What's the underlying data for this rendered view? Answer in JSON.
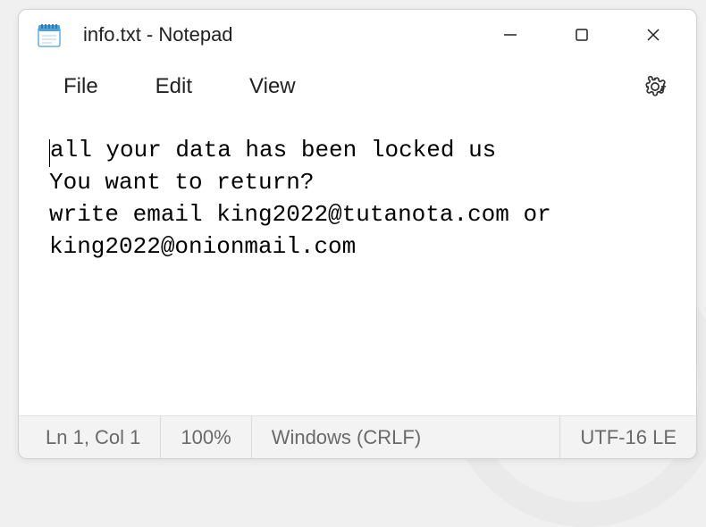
{
  "window": {
    "title": "info.txt - Notepad"
  },
  "menu": {
    "file": "File",
    "edit": "Edit",
    "view": "View"
  },
  "editor": {
    "content": "all your data has been locked us\nYou want to return?\nwrite email king2022@tutanota.com or king2022@onionmail.com"
  },
  "statusbar": {
    "position": "Ln 1, Col 1",
    "zoom": "100%",
    "line_ending": "Windows (CRLF)",
    "encoding": "UTF-16 LE"
  }
}
